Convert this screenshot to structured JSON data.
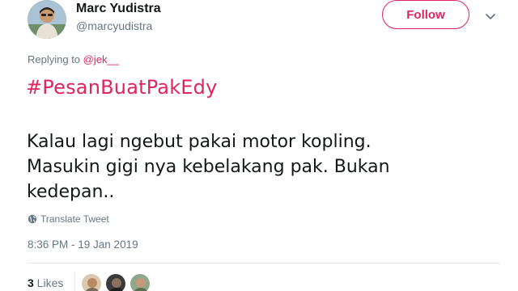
{
  "tweet": {
    "author": {
      "name": "Marc Yudistra",
      "handle": "@marcyudistra"
    },
    "follow_label": "Follow",
    "replying_prefix": "Replying to ",
    "replying_to": "@jek__",
    "hashtag": "#PesanBuatPakEdy",
    "text_lines": [
      "Kalau lagi ngebut pakai motor kopling.",
      "Masukin gigi nya kebelakang pak. Bukan",
      "kedepan.."
    ],
    "translate_label": "Translate Tweet",
    "timestamp": "8:36 PM - 19 Jan 2019",
    "likes": {
      "count": "3",
      "label": " Likes"
    }
  },
  "icons": {
    "menu": "chevron-down-icon",
    "translate": "globe-icon"
  },
  "colors": {
    "accent": "#e0245e",
    "secondary_text": "#657786",
    "primary_text": "#14171a",
    "divider": "#e6ecf0"
  }
}
